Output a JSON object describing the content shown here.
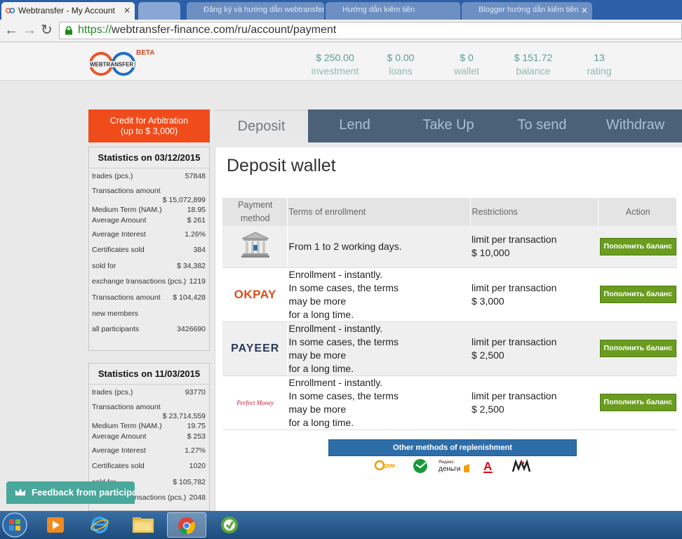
{
  "browser": {
    "active_tab_title": "Webtransfer - My Account",
    "inactive_tabs": [
      "Đăng ký và hướng dẫn webtransfer",
      "Hướng dẫn kiếm tiền",
      "Blogger hướng dẫn kiếm tiền"
    ],
    "url_scheme": "https://",
    "url_rest": "webtransfer-finance.com/ru/account/payment"
  },
  "header": {
    "beta": "BETA",
    "logo_text": "WEBTRANSFER",
    "stats": [
      {
        "value": "$ 250.00",
        "label": "investment"
      },
      {
        "value": "$ 0.00",
        "label": "loans"
      },
      {
        "value": "$ 0",
        "label": "wallet"
      },
      {
        "value": "$ 151.72",
        "label": "balance"
      },
      {
        "value": "13",
        "label": "rating"
      }
    ]
  },
  "sidebar": {
    "credit_line1": "Credit for Arbitration",
    "credit_line2": "(up to $ 3,000)",
    "box1": {
      "title": "Statistics on 03/12/2015",
      "rows": [
        {
          "label": "trades (pcs.)",
          "value": "57848"
        },
        {
          "label": "Transactions amount",
          "value": "$ 15,072,899"
        },
        {
          "label": "Medium Term (NAM.)",
          "value": "18.95"
        },
        {
          "label": "Average Amount",
          "value": "$ 261"
        },
        {
          "label": "Average Interest",
          "value": "1.26%"
        },
        {
          "label": "Certificates sold",
          "value": "384"
        },
        {
          "label": "sold for",
          "value": "$ 34,382"
        },
        {
          "label": "exchange transactions (pcs.)",
          "value": "1219"
        },
        {
          "label": "Transactions amount",
          "value": "$ 104,428"
        },
        {
          "label": "new members",
          "value": ""
        },
        {
          "label": "all participants",
          "value": "3426690"
        }
      ]
    },
    "box2": {
      "title": "Statistics on 11/03/2015",
      "rows": [
        {
          "label": "trades (pcs.)",
          "value": "93770"
        },
        {
          "label": "Transactions amount",
          "value": "$ 23,714,559"
        },
        {
          "label": "Medium Term (NAM.)",
          "value": "19.75"
        },
        {
          "label": "Average Amount",
          "value": "$ 253"
        },
        {
          "label": "Average Interest",
          "value": "1.27%"
        },
        {
          "label": "Certificates sold",
          "value": "1020"
        },
        {
          "label": "sold for",
          "value": "$ 105,782"
        },
        {
          "label": "exchange transactions (pcs.)",
          "value": "2048"
        }
      ]
    },
    "feedback": "Feedback from participants"
  },
  "tabs": [
    "Deposit",
    "Lend",
    "Take Up",
    "To send",
    "Withdraw"
  ],
  "main": {
    "title": "Deposit wallet",
    "columns": {
      "method_l1": "Payment",
      "method_l2": "method",
      "terms": "Terms of enrollment",
      "restrictions": "Restrictions",
      "action": "Action"
    },
    "rows": [
      {
        "method": "bank-icon",
        "terms": [
          "From 1 to 2 working days."
        ],
        "restriction": [
          "limit per transaction",
          "$ 10,000"
        ],
        "action": "Пополнить баланс"
      },
      {
        "method": "OKPAY",
        "terms": [
          "Enrollment - instantly.",
          "In some cases, the terms",
          "may be more",
          "for a long time."
        ],
        "restriction": [
          "limit per transaction",
          "$ 3,000"
        ],
        "action": "Пополнить баланс"
      },
      {
        "method": "PAYEER",
        "terms": [
          "Enrollment - instantly.",
          "In some cases, the terms",
          "may be more",
          "for a long time."
        ],
        "restriction": [
          "limit per transaction",
          "$ 2,500"
        ],
        "action": "Пополнить баланс"
      },
      {
        "method": "Perfect Money",
        "terms": [
          "Enrollment - instantly.",
          "In some cases, the terms",
          "may be more",
          "for a long time."
        ],
        "restriction": [
          "limit per transaction",
          "$ 2,500"
        ],
        "action": "Пополнить баланс"
      }
    ],
    "other_methods": "Other methods of replenishment",
    "pm_icons": {
      "qiwi": "QIWI",
      "yandex1": "Яндекс",
      "yandex2": "деньги",
      "alfa": "А"
    }
  },
  "colors": {
    "accent": "#f04b1a",
    "nav": "#4a6178",
    "teal": "#5a9d96",
    "green": "#6a9c1f"
  }
}
